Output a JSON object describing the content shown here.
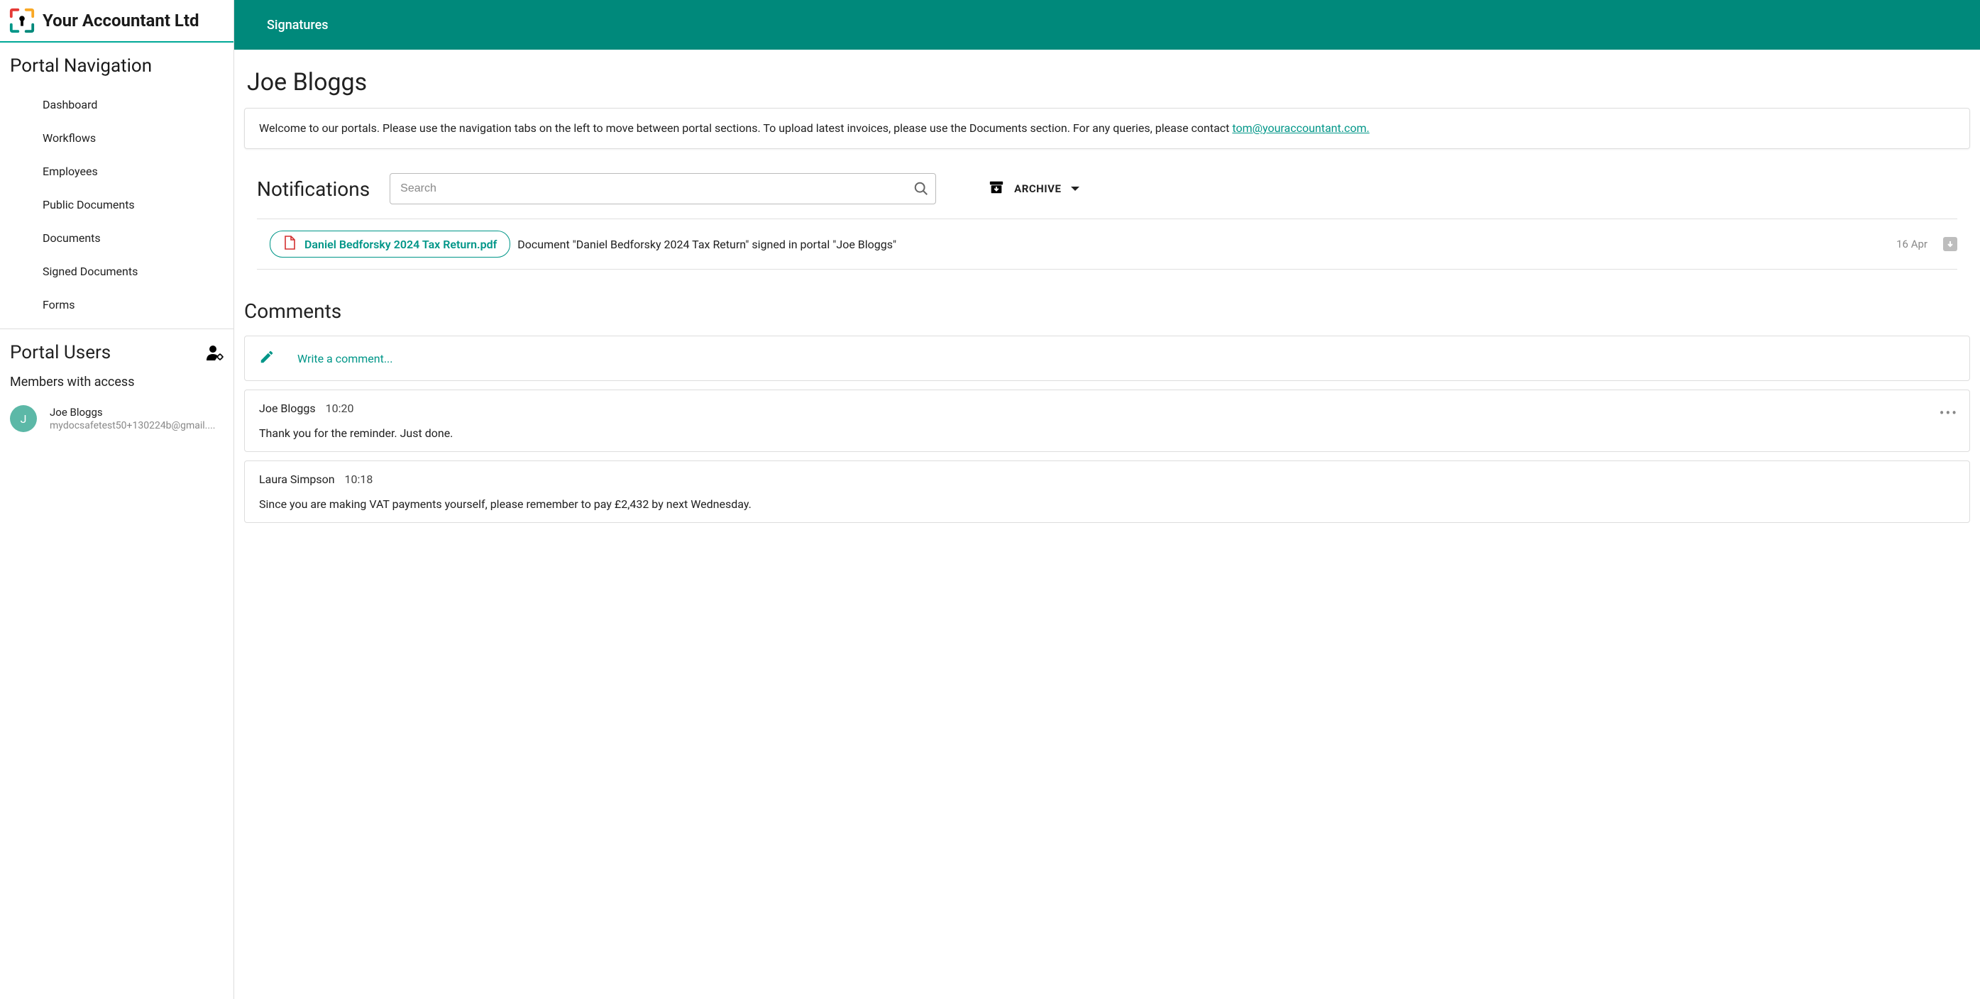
{
  "brand": {
    "name": "Your Accountant Ltd"
  },
  "topbar": {
    "signatures": "Signatures"
  },
  "sidebar": {
    "nav_heading": "Portal Navigation",
    "items": [
      {
        "label": "Dashboard"
      },
      {
        "label": "Workflows"
      },
      {
        "label": "Employees"
      },
      {
        "label": "Public Documents"
      },
      {
        "label": "Documents"
      },
      {
        "label": "Signed Documents"
      },
      {
        "label": "Forms"
      }
    ],
    "users_heading": "Portal Users",
    "members_label": "Members with access",
    "users": [
      {
        "initial": "J",
        "name": "Joe Bloggs",
        "email": "mydocsafetest50+130224b@gmail...."
      }
    ]
  },
  "page": {
    "title": "Joe Bloggs",
    "welcome_text_pre": "Welcome to our portals. Please use the navigation tabs on the left to move between portal sections. To upload latest invoices, please use the Documents section. For any queries, please contact ",
    "welcome_email": "tom@youraccountant.com."
  },
  "notifications": {
    "title": "Notifications",
    "search_placeholder": "Search",
    "archive_label": "ARCHIVE",
    "items": [
      {
        "doc_name": "Daniel Bedforsky 2024 Tax Return.pdf",
        "message": "Document \"Daniel Bedforsky 2024 Tax Return\" signed in portal \"Joe Bloggs\"",
        "date": "16 Apr"
      }
    ]
  },
  "comments": {
    "title": "Comments",
    "compose_placeholder": "Write a comment...",
    "items": [
      {
        "author": "Joe Bloggs",
        "time": "10:20",
        "body": "Thank you for the reminder. Just done.",
        "has_menu": true
      },
      {
        "author": "Laura Simpson",
        "time": "10:18",
        "body": "Since you are making VAT payments yourself, please remember to pay £2,432 by next Wednesday.",
        "has_menu": false
      }
    ]
  }
}
